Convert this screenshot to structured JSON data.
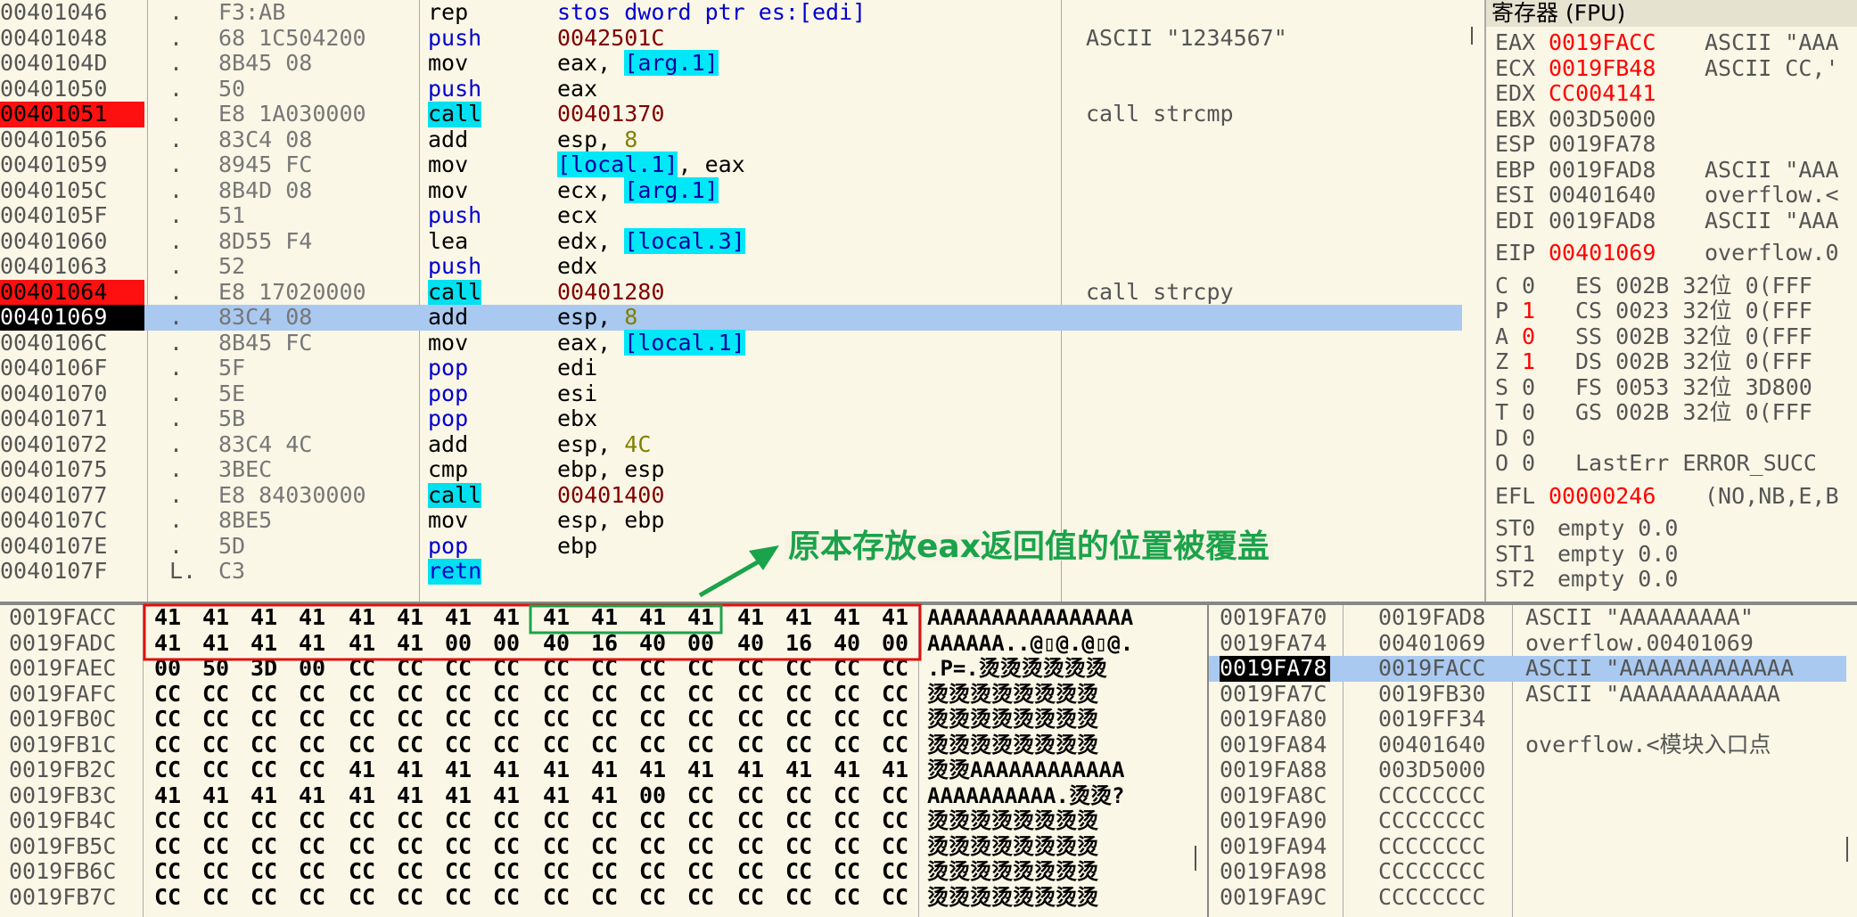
{
  "colors": {
    "background": "#fbf7e6",
    "breakpoint": "#ff1010",
    "current_line": "#a9c9f0",
    "call_highlight": "#00e0f0",
    "changed_register": "#ff0000",
    "annotation_green": "#1aa34a",
    "box_red": "#e01010",
    "box_green": "#1aa34a"
  },
  "disasm": [
    {
      "addr": "00401046",
      "flag": ".",
      "hex": "F3:AB",
      "mn": "rep",
      "mnc": "mnem",
      "op": [
        {
          "t": "stos dword ptr es:[edi]",
          "c": "kw-push"
        }
      ],
      "cm": ""
    },
    {
      "addr": "00401048",
      "flag": ".",
      "hex": "68 1C504200",
      "mn": "push",
      "mnc": "kw-push",
      "op": [
        {
          "t": "0042501C",
          "c": "addrop"
        }
      ],
      "cm": "ASCII \"1234567\""
    },
    {
      "addr": "0040104D",
      "flag": ".",
      "hex": "8B45 08",
      "mn": "mov",
      "mnc": "mnem",
      "op": [
        {
          "t": "eax, ",
          "c": "opnd"
        },
        {
          "t": "[arg.1]",
          "c": "mem"
        }
      ],
      "cm": ""
    },
    {
      "addr": "00401050",
      "flag": ".",
      "hex": "50",
      "mn": "push",
      "mnc": "kw-push",
      "op": [
        {
          "t": "eax",
          "c": "opnd"
        }
      ],
      "cm": ""
    },
    {
      "addr": "00401051",
      "flag": ".",
      "hex": "E8 1A030000",
      "mn": "call",
      "mnc": "kw-call",
      "op": [
        {
          "t": "00401370",
          "c": "addrop"
        }
      ],
      "cm": "call strcmp",
      "bp": true
    },
    {
      "addr": "00401056",
      "flag": ".",
      "hex": "83C4 08",
      "mn": "add",
      "mnc": "mnem",
      "op": [
        {
          "t": "esp, ",
          "c": "opnd"
        },
        {
          "t": "8",
          "c": "imm"
        }
      ],
      "cm": ""
    },
    {
      "addr": "00401059",
      "flag": ".",
      "hex": "8945 FC",
      "mn": "mov",
      "mnc": "mnem",
      "op": [
        {
          "t": "[local.1]",
          "c": "mem"
        },
        {
          "t": ", eax",
          "c": "opnd"
        }
      ],
      "cm": ""
    },
    {
      "addr": "0040105C",
      "flag": ".",
      "hex": "8B4D 08",
      "mn": "mov",
      "mnc": "mnem",
      "op": [
        {
          "t": "ecx, ",
          "c": "opnd"
        },
        {
          "t": "[arg.1]",
          "c": "mem"
        }
      ],
      "cm": ""
    },
    {
      "addr": "0040105F",
      "flag": ".",
      "hex": "51",
      "mn": "push",
      "mnc": "kw-push",
      "op": [
        {
          "t": "ecx",
          "c": "opnd"
        }
      ],
      "cm": ""
    },
    {
      "addr": "00401060",
      "flag": ".",
      "hex": "8D55 F4",
      "mn": "lea",
      "mnc": "mnem",
      "op": [
        {
          "t": "edx, ",
          "c": "opnd"
        },
        {
          "t": "[local.3]",
          "c": "mem"
        }
      ],
      "cm": ""
    },
    {
      "addr": "00401063",
      "flag": ".",
      "hex": "52",
      "mn": "push",
      "mnc": "kw-push",
      "op": [
        {
          "t": "edx",
          "c": "opnd"
        }
      ],
      "cm": ""
    },
    {
      "addr": "00401064",
      "flag": ".",
      "hex": "E8 17020000",
      "mn": "call",
      "mnc": "kw-call",
      "op": [
        {
          "t": "00401280",
          "c": "addrop"
        }
      ],
      "cm": "call strcpy",
      "bp": true
    },
    {
      "addr": "00401069",
      "flag": ".",
      "hex": "83C4 08",
      "mn": "add",
      "mnc": "mnem",
      "op": [
        {
          "t": "esp, ",
          "c": "opnd"
        },
        {
          "t": "8",
          "c": "imm"
        }
      ],
      "cm": "",
      "eip": true
    },
    {
      "addr": "0040106C",
      "flag": ".",
      "hex": "8B45 FC",
      "mn": "mov",
      "mnc": "mnem",
      "op": [
        {
          "t": "eax, ",
          "c": "opnd"
        },
        {
          "t": "[local.1]",
          "c": "mem"
        }
      ],
      "cm": ""
    },
    {
      "addr": "0040106F",
      "flag": ".",
      "hex": "5F",
      "mn": "pop",
      "mnc": "kw-pop",
      "op": [
        {
          "t": "edi",
          "c": "opnd"
        }
      ],
      "cm": ""
    },
    {
      "addr": "00401070",
      "flag": ".",
      "hex": "5E",
      "mn": "pop",
      "mnc": "kw-pop",
      "op": [
        {
          "t": "esi",
          "c": "opnd"
        }
      ],
      "cm": ""
    },
    {
      "addr": "00401071",
      "flag": ".",
      "hex": "5B",
      "mn": "pop",
      "mnc": "kw-pop",
      "op": [
        {
          "t": "ebx",
          "c": "opnd"
        }
      ],
      "cm": ""
    },
    {
      "addr": "00401072",
      "flag": ".",
      "hex": "83C4 4C",
      "mn": "add",
      "mnc": "mnem",
      "op": [
        {
          "t": "esp, ",
          "c": "opnd"
        },
        {
          "t": "4C",
          "c": "imm"
        }
      ],
      "cm": ""
    },
    {
      "addr": "00401075",
      "flag": ".",
      "hex": "3BEC",
      "mn": "cmp",
      "mnc": "mnem",
      "op": [
        {
          "t": "ebp, esp",
          "c": "opnd"
        }
      ],
      "cm": ""
    },
    {
      "addr": "00401077",
      "flag": ".",
      "hex": "E8 84030000",
      "mn": "call",
      "mnc": "kw-call",
      "op": [
        {
          "t": "00401400",
          "c": "addrop"
        }
      ],
      "cm": ""
    },
    {
      "addr": "0040107C",
      "flag": ".",
      "hex": "8BE5",
      "mn": "mov",
      "mnc": "mnem",
      "op": [
        {
          "t": "esp, ebp",
          "c": "opnd"
        }
      ],
      "cm": ""
    },
    {
      "addr": "0040107E",
      "flag": ".",
      "hex": "5D",
      "mn": "pop",
      "mnc": "kw-pop",
      "op": [
        {
          "t": "ebp",
          "c": "opnd"
        }
      ],
      "cm": ""
    },
    {
      "addr": "0040107F",
      "flag": "L.",
      "hex": "C3",
      "mn": "retn",
      "mnc": "kw-ret",
      "op": [],
      "cm": ""
    }
  ],
  "registers": {
    "title": "寄存器 (FPU)",
    "gp": [
      {
        "n": "EAX",
        "v": "0019FACC",
        "chg": true,
        "c": "ASCII \"AAA"
      },
      {
        "n": "ECX",
        "v": "0019FB48",
        "chg": true,
        "c": "ASCII CC,'"
      },
      {
        "n": "EDX",
        "v": "CC004141",
        "chg": true,
        "c": ""
      },
      {
        "n": "EBX",
        "v": "003D5000",
        "chg": false,
        "c": ""
      },
      {
        "n": "ESP",
        "v": "0019FA78",
        "chg": false,
        "c": ""
      },
      {
        "n": "EBP",
        "v": "0019FAD8",
        "chg": false,
        "c": "ASCII \"AAA"
      },
      {
        "n": "ESI",
        "v": "00401640",
        "chg": false,
        "c": "overflow.<"
      },
      {
        "n": "EDI",
        "v": "0019FAD8",
        "chg": false,
        "c": "ASCII \"AAA"
      }
    ],
    "eip": {
      "n": "EIP",
      "v": "00401069",
      "c": "overflow.0"
    },
    "flags": [
      {
        "f": "C",
        "v": "0",
        "chg": false,
        "seg": "ES 002B 32位 0(FFF"
      },
      {
        "f": "P",
        "v": "1",
        "chg": true,
        "seg": "CS 0023 32位 0(FFF"
      },
      {
        "f": "A",
        "v": "0",
        "chg": true,
        "seg": "SS 002B 32位 0(FFF"
      },
      {
        "f": "Z",
        "v": "1",
        "chg": true,
        "seg": "DS 002B 32位 0(FFF"
      },
      {
        "f": "S",
        "v": "0",
        "chg": false,
        "seg": "FS 0053 32位 3D800"
      },
      {
        "f": "T",
        "v": "0",
        "chg": false,
        "seg": "GS 002B 32位 0(FFF"
      },
      {
        "f": "D",
        "v": "0",
        "chg": false,
        "seg": ""
      },
      {
        "f": "O",
        "v": "0",
        "chg": false,
        "seg": "LastErr ERROR_SUCC"
      }
    ],
    "efl": {
      "n": "EFL",
      "v": "00000246",
      "c": "(NO,NB,E,B"
    },
    "fpu": [
      {
        "n": "ST0",
        "c": "empty 0.0"
      },
      {
        "n": "ST1",
        "c": "empty 0.0"
      },
      {
        "n": "ST2",
        "c": "empty 0.0"
      }
    ]
  },
  "dump": [
    {
      "a": "0019FACC",
      "b": [
        "41",
        "41",
        "41",
        "41",
        "41",
        "41",
        "41",
        "41",
        "41",
        "41",
        "41",
        "41",
        "41",
        "41",
        "41",
        "41"
      ],
      "s": "AAAAAAAAAAAAAAAA"
    },
    {
      "a": "0019FADC",
      "b": [
        "41",
        "41",
        "41",
        "41",
        "41",
        "41",
        "00",
        "00",
        "40",
        "16",
        "40",
        "00",
        "40",
        "16",
        "40",
        "00"
      ],
      "s": "AAAAAA..@▯@.@▯@."
    },
    {
      "a": "0019FAEC",
      "b": [
        "00",
        "50",
        "3D",
        "00",
        "CC",
        "CC",
        "CC",
        "CC",
        "CC",
        "CC",
        "CC",
        "CC",
        "CC",
        "CC",
        "CC",
        "CC"
      ],
      "s": ".P=.烫烫烫烫烫烫"
    },
    {
      "a": "0019FAFC",
      "b": [
        "CC",
        "CC",
        "CC",
        "CC",
        "CC",
        "CC",
        "CC",
        "CC",
        "CC",
        "CC",
        "CC",
        "CC",
        "CC",
        "CC",
        "CC",
        "CC"
      ],
      "s": "烫烫烫烫烫烫烫烫"
    },
    {
      "a": "0019FB0C",
      "b": [
        "CC",
        "CC",
        "CC",
        "CC",
        "CC",
        "CC",
        "CC",
        "CC",
        "CC",
        "CC",
        "CC",
        "CC",
        "CC",
        "CC",
        "CC",
        "CC"
      ],
      "s": "烫烫烫烫烫烫烫烫"
    },
    {
      "a": "0019FB1C",
      "b": [
        "CC",
        "CC",
        "CC",
        "CC",
        "CC",
        "CC",
        "CC",
        "CC",
        "CC",
        "CC",
        "CC",
        "CC",
        "CC",
        "CC",
        "CC",
        "CC"
      ],
      "s": "烫烫烫烫烫烫烫烫"
    },
    {
      "a": "0019FB2C",
      "b": [
        "CC",
        "CC",
        "CC",
        "CC",
        "41",
        "41",
        "41",
        "41",
        "41",
        "41",
        "41",
        "41",
        "41",
        "41",
        "41",
        "41"
      ],
      "s": "烫烫AAAAAAAAAAAA"
    },
    {
      "a": "0019FB3C",
      "b": [
        "41",
        "41",
        "41",
        "41",
        "41",
        "41",
        "41",
        "41",
        "41",
        "41",
        "00",
        "CC",
        "CC",
        "CC",
        "CC",
        "CC"
      ],
      "s": "AAAAAAAAAA.烫烫?"
    },
    {
      "a": "0019FB4C",
      "b": [
        "CC",
        "CC",
        "CC",
        "CC",
        "CC",
        "CC",
        "CC",
        "CC",
        "CC",
        "CC",
        "CC",
        "CC",
        "CC",
        "CC",
        "CC",
        "CC"
      ],
      "s": "烫烫烫烫烫烫烫烫"
    },
    {
      "a": "0019FB5C",
      "b": [
        "CC",
        "CC",
        "CC",
        "CC",
        "CC",
        "CC",
        "CC",
        "CC",
        "CC",
        "CC",
        "CC",
        "CC",
        "CC",
        "CC",
        "CC",
        "CC"
      ],
      "s": "烫烫烫烫烫烫烫烫"
    },
    {
      "a": "0019FB6C",
      "b": [
        "CC",
        "CC",
        "CC",
        "CC",
        "CC",
        "CC",
        "CC",
        "CC",
        "CC",
        "CC",
        "CC",
        "CC",
        "CC",
        "CC",
        "CC",
        "CC"
      ],
      "s": "烫烫烫烫烫烫烫烫"
    },
    {
      "a": "0019FB7C",
      "b": [
        "CC",
        "CC",
        "CC",
        "CC",
        "CC",
        "CC",
        "CC",
        "CC",
        "CC",
        "CC",
        "CC",
        "CC",
        "CC",
        "CC",
        "CC",
        "CC"
      ],
      "s": "烫烫烫烫烫烫烫烫"
    }
  ],
  "stack": [
    {
      "a": "0019FA70",
      "v": "0019FAD8",
      "c": "ASCII \"AAAAAAAAA\""
    },
    {
      "a": "0019FA74",
      "v": "00401069",
      "c": "overflow.00401069"
    },
    {
      "a": "0019FA78",
      "v": "0019FACC",
      "c": "ASCII \"AAAAAAAAAAAAA",
      "cur": true
    },
    {
      "a": "0019FA7C",
      "v": "0019FB30",
      "c": "ASCII \"AAAAAAAAAAAA"
    },
    {
      "a": "0019FA80",
      "v": "0019FF34",
      "c": ""
    },
    {
      "a": "0019FA84",
      "v": "00401640",
      "c": "overflow.<模块入口点"
    },
    {
      "a": "0019FA88",
      "v": "003D5000",
      "c": ""
    },
    {
      "a": "0019FA8C",
      "v": "CCCCCCCC",
      "c": ""
    },
    {
      "a": "0019FA90",
      "v": "CCCCCCCC",
      "c": ""
    },
    {
      "a": "0019FA94",
      "v": "CCCCCCCC",
      "c": ""
    },
    {
      "a": "0019FA98",
      "v": "CCCCCCCC",
      "c": ""
    },
    {
      "a": "0019FA9C",
      "v": "CCCCCCCC",
      "c": ""
    }
  ],
  "annotation": {
    "text": "原本存放eax返回值的位置被覆盖"
  }
}
